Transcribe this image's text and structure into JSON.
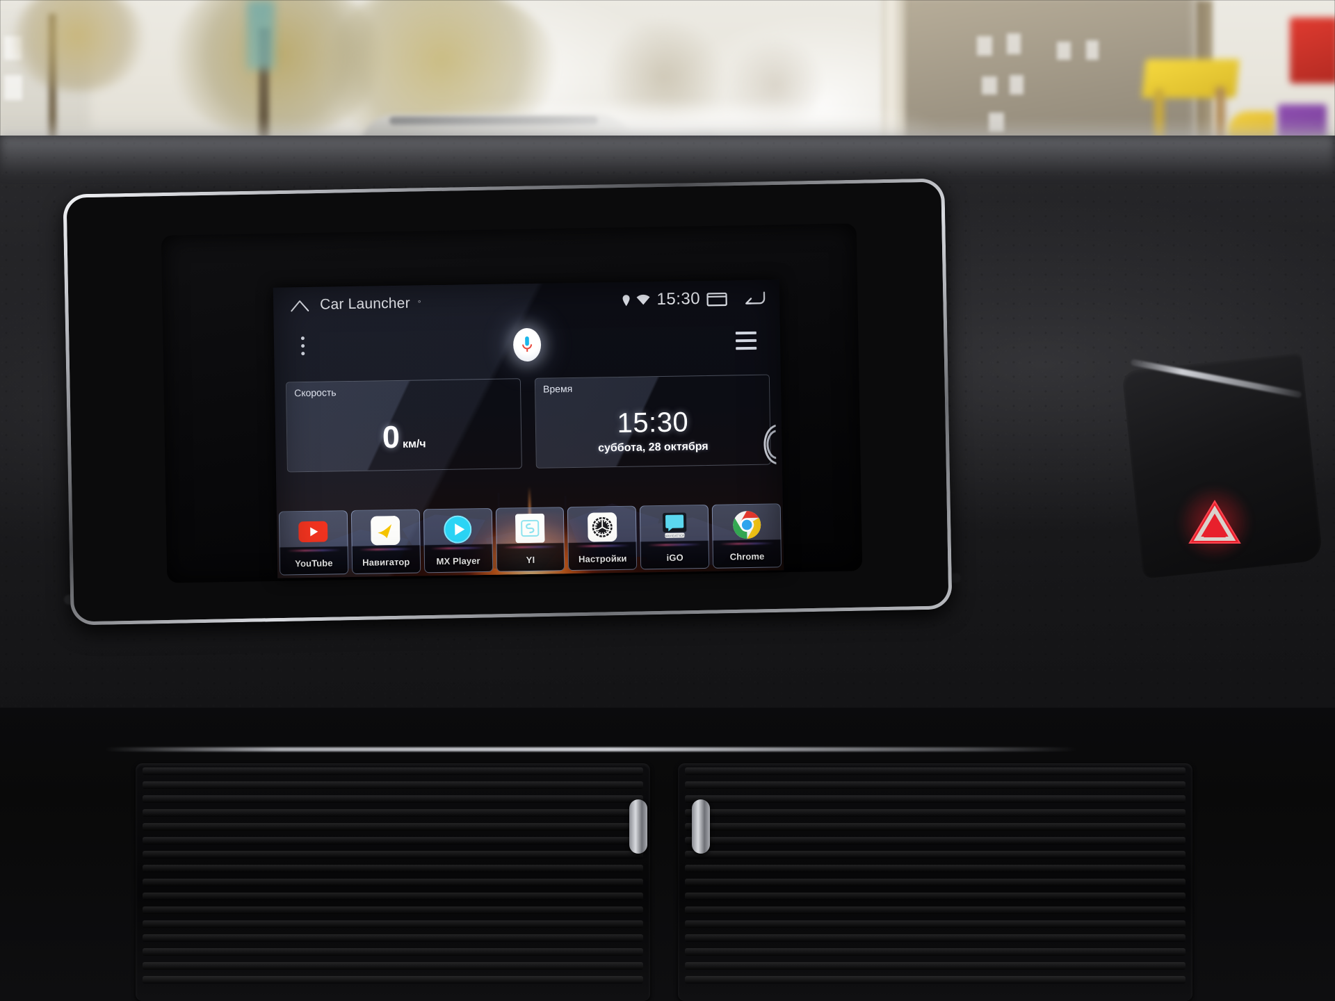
{
  "scene": {
    "description": "Android car head unit running Car Launcher, mounted in a car dashboard",
    "outside": {
      "weather": "overcast autumn day",
      "elements": [
        "autumn-trees",
        "apartment-building",
        "childrens-playground",
        "parked-car",
        "road"
      ]
    }
  },
  "statusbar": {
    "home_icon": "home-icon",
    "app_title": "Car Launcher",
    "package_dot": "°",
    "location_icon": "location-pin-icon",
    "wifi_icon": "wifi-icon",
    "clock": "15:30",
    "recents_icon": "recents-icon",
    "back_icon": "back-icon"
  },
  "toolbar": {
    "overflow_label": "overflow-menu",
    "mic_label": "voice-assistant",
    "menu_label": "app-drawer"
  },
  "widgets": [
    {
      "name": "speed",
      "label": "Скорость",
      "value": "0",
      "unit": "км/ч"
    },
    {
      "name": "clock",
      "label": "Время",
      "value": "15:30",
      "date": "суббота, 28 октября"
    }
  ],
  "dock": [
    {
      "label": "YouTube",
      "icon": "youtube-icon"
    },
    {
      "label": "Навигатор",
      "icon": "yandex-navigator-icon"
    },
    {
      "label": "MX Player",
      "icon": "mx-player-icon"
    },
    {
      "label": "YI",
      "icon": "yi-camera-icon"
    },
    {
      "label": "Настройки",
      "icon": "settings-gear-icon"
    },
    {
      "label": "iGO",
      "icon": "igo-navigation-icon"
    },
    {
      "label": "Chrome",
      "icon": "chrome-icon"
    }
  ],
  "page_indicator": {
    "name": "page-scroll-arc"
  },
  "car_controls": {
    "hazard_button": {
      "name": "hazard-lights-button",
      "icon": "warning-triangle-icon",
      "color": "#e8202c"
    }
  },
  "colors": {
    "screen_bg": "#0c0d14",
    "wallpaper_glow": "#ff6a1e",
    "widget_border": "#bac4dc",
    "dock_tile_top": "#8092ba",
    "text_primary": "#ffffff",
    "status_text": "#eef0f6",
    "hazard_red": "#e8202c",
    "mic_blue": "#19b6ea",
    "mic_red": "#e8483c"
  }
}
